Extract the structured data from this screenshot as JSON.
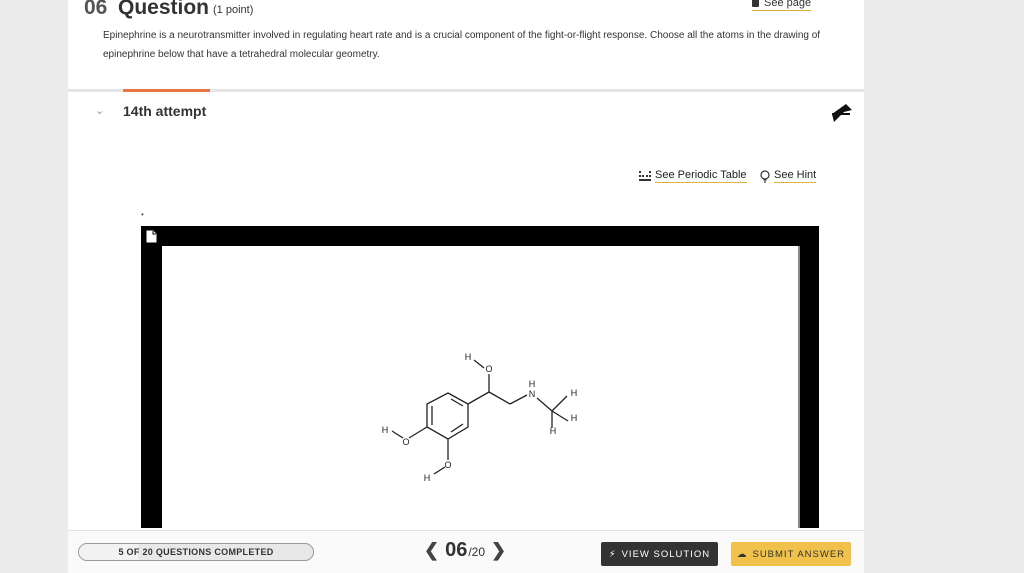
{
  "header": {
    "number": "06",
    "title": "Question",
    "points": "(1 point)",
    "see_page": "See page"
  },
  "question_text": "Epinephrine is a neurotransmitter involved in regulating heart rate and is a crucial component of the fight-or-flight response. Choose all the atoms in the drawing of epinephrine below that have a tetrahedral molecular geometry.",
  "attempt": {
    "label": "14th attempt"
  },
  "links": {
    "periodic_table": "See Periodic Table",
    "hint": "See Hint"
  },
  "molecule": {
    "h_top": "H",
    "o_top": "O",
    "h_nh": "H",
    "n": "N",
    "h_methyl_1": "H",
    "h_methyl_2": "H",
    "h_methyl_3": "H",
    "h_left": "H",
    "o_left": "O",
    "o_bottom": "O",
    "h_bottom": "H"
  },
  "footer": {
    "progress_label": "5 OF 20 QUESTIONS COMPLETED",
    "progress_fraction": 0.25,
    "current": "06",
    "total": "/20",
    "view_solution": "VIEW SOLUTION",
    "submit_answer": "SUBMIT ANSWER"
  },
  "colors": {
    "accent": "#e8734a",
    "link_underline": "#e0b13b",
    "submit": "#f0c24b",
    "view": "#333333"
  }
}
